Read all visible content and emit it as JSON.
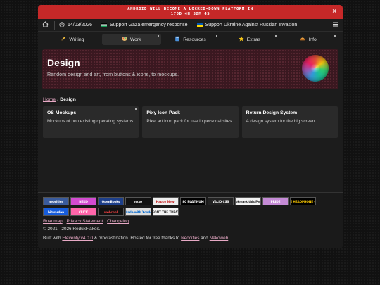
{
  "alert": {
    "line1": "ANDROID WILL BECOME A LOCKED-DOWN PLATFORM IN",
    "line2": "170D 4H 32M 4S",
    "close": "×"
  },
  "topbar": {
    "date": "14/03/2026",
    "gaza": "Support Gaza emergency response",
    "ukraine": "Support Ukraine Against Russian Invasion"
  },
  "nav": {
    "tabs": [
      {
        "label": "Writing",
        "icon": "pencil-icon"
      },
      {
        "label": "Work",
        "icon": "palette-icon"
      },
      {
        "label": "Resources",
        "icon": "book-icon"
      },
      {
        "label": "Extras",
        "icon": "star-icon"
      },
      {
        "label": "Info",
        "icon": "info-icon"
      }
    ],
    "active": "Work"
  },
  "hero": {
    "title": "Design",
    "subtitle": "Random design and art, from buttons & icons, to mockups."
  },
  "breadcrumb": {
    "home": "Home",
    "separator": "›",
    "current": "Design"
  },
  "cards": [
    {
      "title": "OS Mockups",
      "desc": "Mockups of non existing operating systems"
    },
    {
      "title": "Pixy Icon Pack",
      "desc": "Pixel art icon pack for use in personal sites"
    },
    {
      "title": "Return Design System",
      "desc": "A design system for the big screen"
    }
  ],
  "badges": [
    {
      "text": "neocities",
      "bg": "#3a5b9c",
      "fg": "#ffffff"
    },
    {
      "text": "NEKO",
      "bg": "#d34bd0",
      "fg": "#ffffff"
    },
    {
      "text": "OpenBooks",
      "bg": "#1d3f8a",
      "fg": "#ffffff"
    },
    {
      "text": "nkko",
      "bg": "#111111",
      "fg": "#ffffff"
    },
    {
      "text": "Happy New!",
      "bg": "#eeeeee",
      "fg": "#c62828"
    },
    {
      "text": "80 PLATINUM",
      "bg": "#000000",
      "fg": "#ffffff"
    },
    {
      "text": "VALID CSS",
      "bg": "#222222",
      "fg": "#ffffff"
    },
    {
      "text": "Bookmark this Page!",
      "bg": "#f2f2f2",
      "fg": "#222222"
    },
    {
      "text": "PRIDE",
      "bg": "#c58bd6",
      "fg": "#ffffff"
    },
    {
      "text": "BORN IN THE HEADPHONE GENERATION",
      "bg": "#000000",
      "fg": "#ffcc00"
    },
    {
      "text": "bitwarden",
      "bg": "#175ddc",
      "fg": "#ffffff"
    },
    {
      "text": "CLICK",
      "bg": "#ff66aa",
      "fg": "#ffffff"
    },
    {
      "text": "webchnl",
      "bg": "#111111",
      "fg": "#ff4444"
    },
    {
      "text": "Made with Xcode",
      "bg": "#dddddd",
      "fg": "#0066cc"
    },
    {
      "text": "FONT THE TREAT",
      "bg": "#f4f4f4",
      "fg": "#333333"
    }
  ],
  "footer": {
    "links": [
      "Roadmap",
      "Privacy Statement",
      "Changelog"
    ],
    "copyright": "© 2021 - 2026 ReduxFlakes.",
    "built_prefix": "Built with ",
    "eleventy": "Eleventy v4.0.0",
    "built_mid": " & procrastination. Hosted for free thanks to ",
    "neocities": "Neocities",
    "and": " and ",
    "nekoweb": "Nekoweb",
    "dot": "."
  }
}
